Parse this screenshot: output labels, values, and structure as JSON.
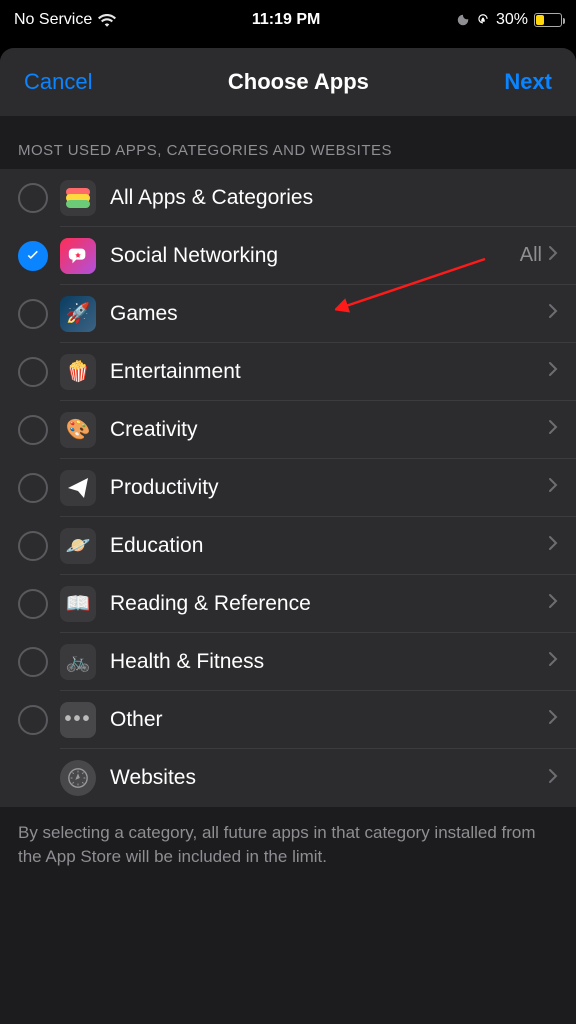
{
  "status": {
    "carrier": "No Service",
    "time": "11:19 PM",
    "battery_pct": "30%"
  },
  "nav": {
    "cancel": "Cancel",
    "title": "Choose Apps",
    "next": "Next"
  },
  "section_header": "MOST USED APPS, CATEGORIES AND WEBSITES",
  "rows": {
    "all": {
      "label": "All Apps & Categories"
    },
    "social": {
      "label": "Social Networking",
      "detail": "All"
    },
    "games": {
      "label": "Games"
    },
    "entertainment": {
      "label": "Entertainment"
    },
    "creativity": {
      "label": "Creativity"
    },
    "productivity": {
      "label": "Productivity"
    },
    "education": {
      "label": "Education"
    },
    "reading": {
      "label": "Reading & Reference"
    },
    "health": {
      "label": "Health & Fitness"
    },
    "other": {
      "label": "Other"
    },
    "websites": {
      "label": "Websites"
    }
  },
  "footer": "By selecting a category, all future apps in that category installed from the App Store will be included in the limit."
}
